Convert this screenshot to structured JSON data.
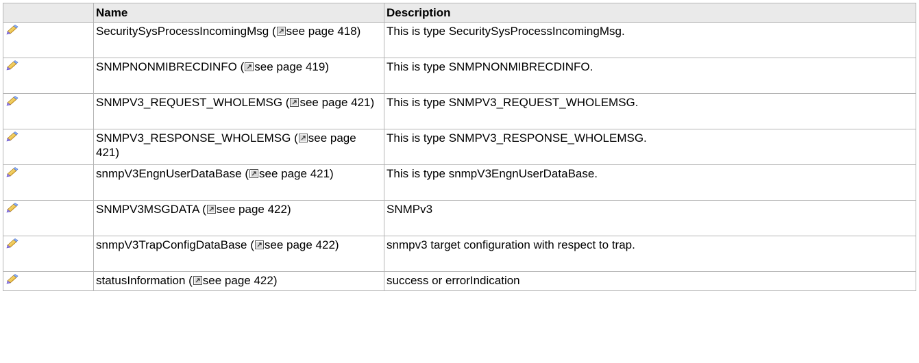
{
  "table": {
    "headers": {
      "icon": "",
      "name": "Name",
      "description": "Description"
    },
    "rows": [
      {
        "icon": "typedef-icon",
        "name": "SecuritySysProcessIncomingMsg (",
        "link": "see page 418)",
        "description": "This is type SecuritySysProcessIncomingMsg."
      },
      {
        "icon": "typedef-icon",
        "name": "SNMPNONMIBRECDINFO (",
        "link": "see page 419)",
        "description": "This is type SNMPNONMIBRECDINFO."
      },
      {
        "icon": "typedef-icon",
        "name": "SNMPV3_REQUEST_WHOLEMSG (",
        "link": "see page 421)",
        "description": "This is type SNMPV3_REQUEST_WHOLEMSG."
      },
      {
        "icon": "typedef-icon",
        "name": "SNMPV3_RESPONSE_WHOLEMSG (",
        "link": "see page 421)",
        "description": "This is type SNMPV3_RESPONSE_WHOLEMSG."
      },
      {
        "icon": "typedef-icon",
        "name": "snmpV3EngnUserDataBase (",
        "link": "see page 421)",
        "description": "This is type snmpV3EngnUserDataBase."
      },
      {
        "icon": "typedef-icon",
        "name": "SNMPV3MSGDATA (",
        "link": "see page 422)",
        "description": "SNMPv3"
      },
      {
        "icon": "typedef-icon",
        "name": "snmpV3TrapConfigDataBase (",
        "link": "see page 422)",
        "description": "snmpv3 target configuration with respect to trap."
      },
      {
        "icon": "typedef-icon",
        "name": "statusInformation (",
        "link": "see page 422)",
        "description": "success or errorIndication"
      }
    ]
  }
}
